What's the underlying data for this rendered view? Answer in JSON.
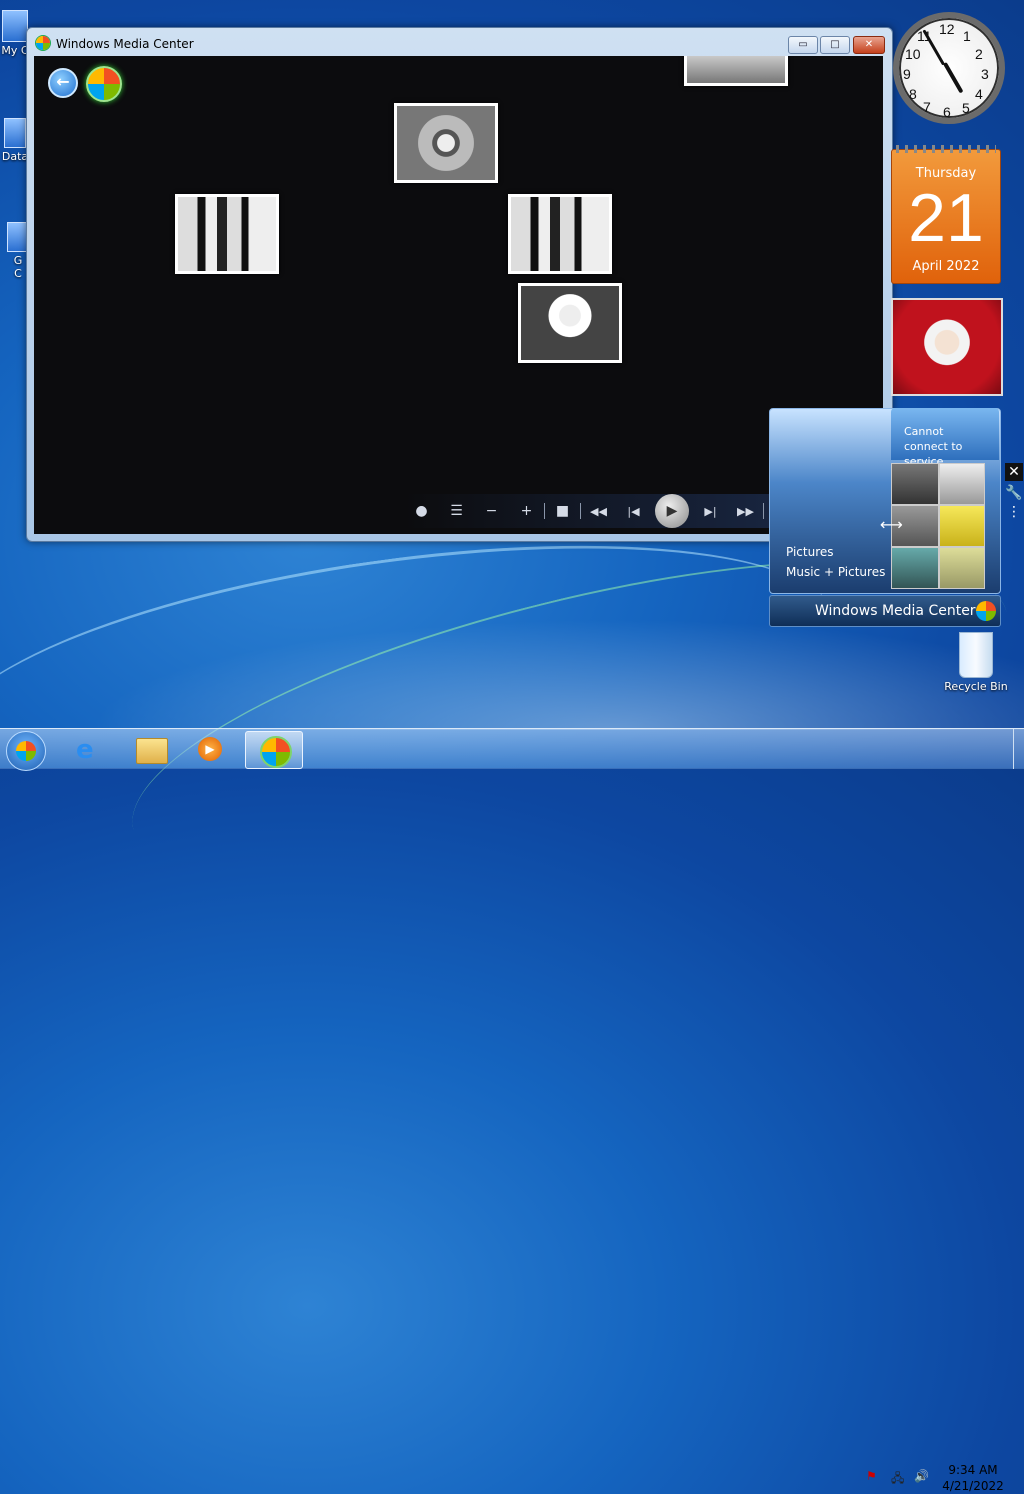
{
  "desktop": {
    "icons": [
      {
        "label": "My C"
      },
      {
        "label": "Data"
      },
      {
        "label": "G"
      },
      {
        "label": "C"
      }
    ],
    "recycle_bin": "Recycle Bin"
  },
  "wmc_window": {
    "title": "Windows Media Center",
    "controls": {
      "minimize": "▭",
      "maximize": "□",
      "close": "✕"
    },
    "transport": {
      "record": "●",
      "list": "☰",
      "minus": "−",
      "plus": "+",
      "stop": "■",
      "rewind": "◀◀",
      "prev": "|◀",
      "play": "▶",
      "next": "▶|",
      "fast_forward": "▶▶",
      "volume": "🔊",
      "vol_minus": "−",
      "vol_plus": "+"
    }
  },
  "clock_gadget": {
    "numbers": [
      "12",
      "1",
      "2",
      "3",
      "4",
      "5",
      "6",
      "7",
      "8",
      "9",
      "10",
      "11"
    ]
  },
  "calendar_gadget": {
    "weekday": "Thursday",
    "day": "21",
    "month_year": "April 2022"
  },
  "wmc_gadget": {
    "message": "Cannot connect to service",
    "items": [
      "Pictures",
      "Music + Pictures"
    ],
    "bar_label": "Windows Media Center",
    "side_buttons": {
      "close": "✕",
      "settings": "🔧",
      "drag": "⋮"
    }
  },
  "taskbar": {
    "time": "9:34 AM",
    "date": "4/21/2022"
  }
}
